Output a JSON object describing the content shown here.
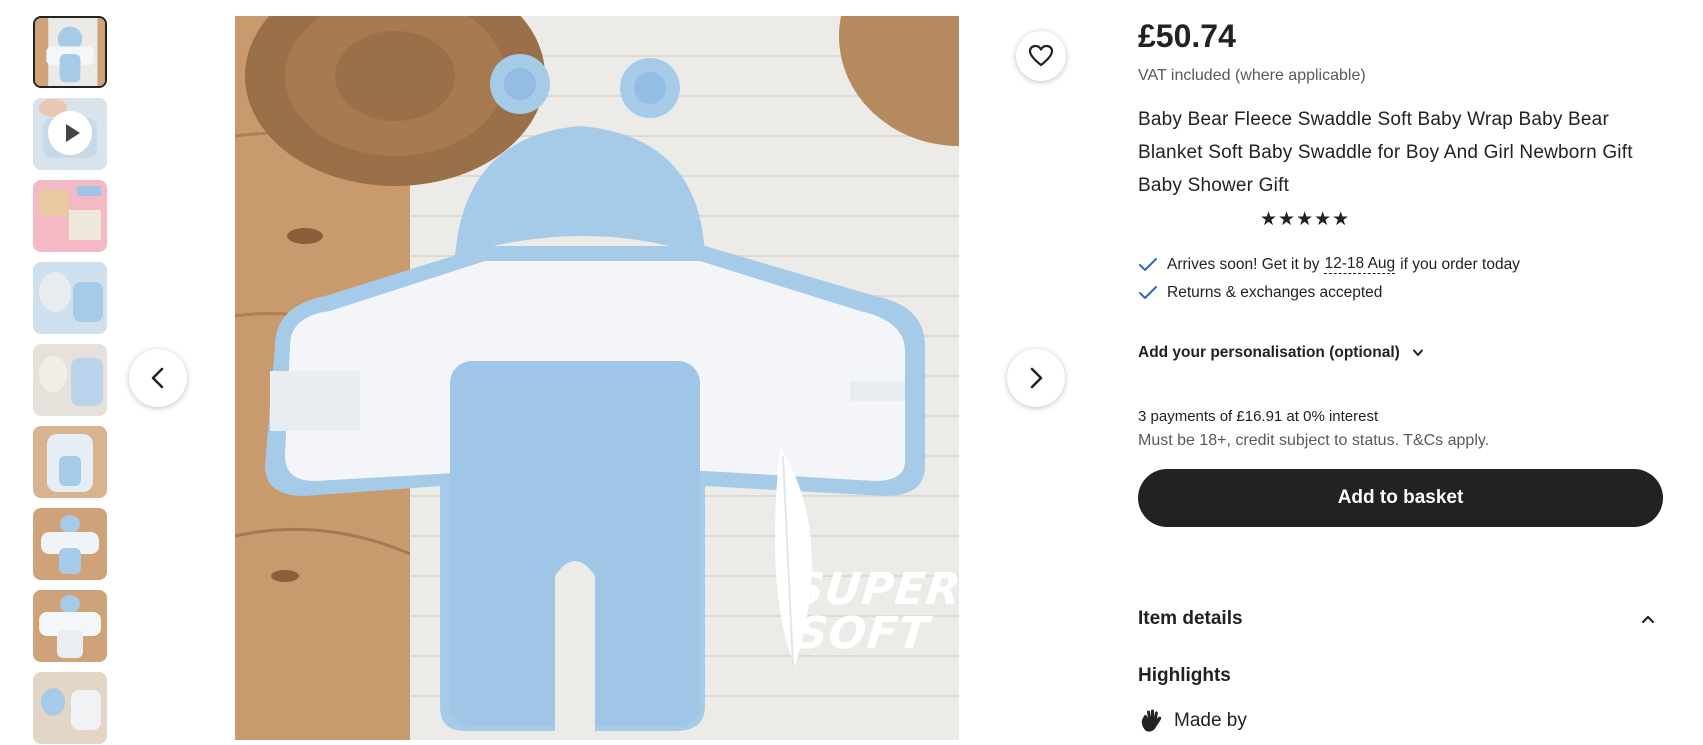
{
  "gallery": {
    "thumbnails": [
      {
        "kind": "image",
        "selected": true
      },
      {
        "kind": "video",
        "icon": "play-icon"
      },
      {
        "kind": "image"
      },
      {
        "kind": "image"
      },
      {
        "kind": "image"
      },
      {
        "kind": "image"
      },
      {
        "kind": "image"
      },
      {
        "kind": "image"
      },
      {
        "kind": "image"
      }
    ],
    "watermark_line1": "SUPER",
    "watermark_line2": "SOFT",
    "prev_icon": "chevron-left-icon",
    "next_icon": "chevron-right-icon",
    "favorite_icon": "heart-icon"
  },
  "listing": {
    "price": "£50.74",
    "vat_note": "VAT included (where applicable)",
    "title": "Baby Bear Fleece Swaddle Soft Baby Wrap Baby Bear Blanket Soft Baby Swaddle for Boy And Girl Newborn Gift Baby Shower Gift",
    "rating_stars": "★★★★★",
    "rating": 5
  },
  "shipping": {
    "arrives_prefix": "Arrives soon! Get it by",
    "arrives_dates": "12-18 Aug",
    "arrives_suffix": "if you order today",
    "returns": "Returns & exchanges accepted"
  },
  "personalisation": {
    "label": "Add your personalisation (optional)"
  },
  "payment": {
    "installments": "3 payments of £16.91 at 0% interest",
    "terms": "Must be 18+, credit subject to status. T&Cs apply."
  },
  "actions": {
    "add_to_basket": "Add to basket"
  },
  "item_details": {
    "heading": "Item details",
    "highlights_heading": "Highlights",
    "made_by": "Made by"
  },
  "colors": {
    "text": "#222222",
    "muted": "#595959",
    "button_bg": "#222222",
    "check_blue": "#2f66c5",
    "swaddle_blue": "#a6cbe9"
  }
}
